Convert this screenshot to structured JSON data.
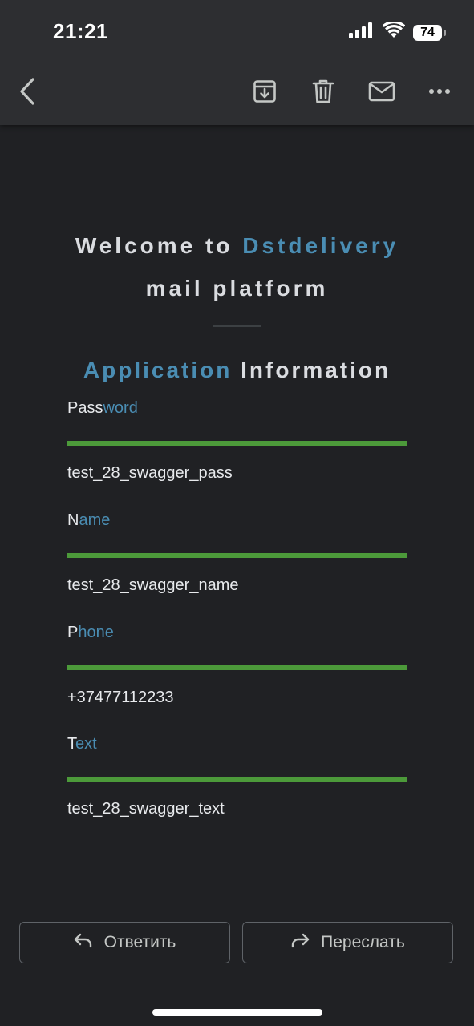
{
  "status_bar": {
    "time": "21:21",
    "battery": "74"
  },
  "toolbar": {
    "back_icon": "chevron-left-icon",
    "archive_icon": "archive-icon",
    "delete_icon": "trash-icon",
    "mark_unread_icon": "mail-icon",
    "more_icon": "more-horizontal-icon"
  },
  "email": {
    "welcome_prefix": "Welcome to ",
    "brand": "Dstdelivery",
    "welcome_line2": "mail platform",
    "section_accent": "Application",
    "section_rest": " Information",
    "fields": [
      {
        "label_head": "Pass",
        "label_tail": "word",
        "value": "test_28_swagger_pass"
      },
      {
        "label_head": "N",
        "label_tail": "ame",
        "value": "test_28_swagger_name"
      },
      {
        "label_head": "P",
        "label_tail": "hone",
        "value": "+37477112233"
      },
      {
        "label_head": "T",
        "label_tail": "ext",
        "value": "test_28_swagger_text"
      }
    ]
  },
  "actions": {
    "reply_label": "Ответить",
    "forward_label": "Переслать"
  },
  "colors": {
    "background": "#202124",
    "toolbar": "#2d2e31",
    "accent": "#4a8db3",
    "field_line": "#4c9a3a"
  }
}
